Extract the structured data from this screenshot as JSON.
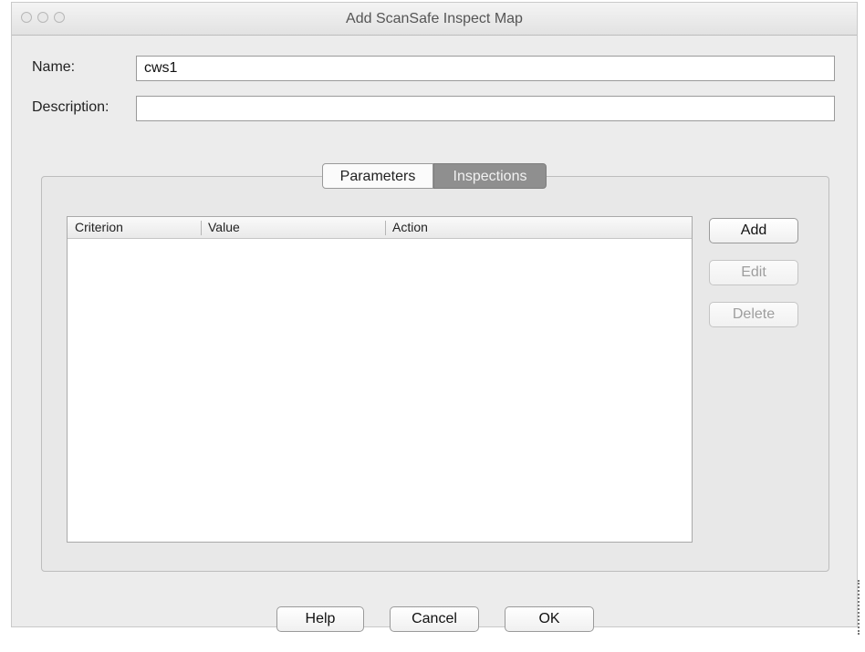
{
  "window": {
    "title": "Add ScanSafe Inspect Map"
  },
  "form": {
    "name_label": "Name:",
    "name_value": "cws1",
    "description_label": "Description:",
    "description_value": ""
  },
  "tabs": [
    {
      "label": "Parameters",
      "selected": false
    },
    {
      "label": "Inspections",
      "selected": true
    }
  ],
  "table": {
    "columns": [
      "Criterion",
      "Value",
      "Action"
    ],
    "rows": []
  },
  "side_buttons": {
    "add": "Add",
    "edit": "Edit",
    "delete": "Delete"
  },
  "footer_buttons": {
    "help": "Help",
    "cancel": "Cancel",
    "ok": "OK"
  },
  "icons": [
    "close-icon",
    "minimize-icon",
    "zoom-icon"
  ]
}
